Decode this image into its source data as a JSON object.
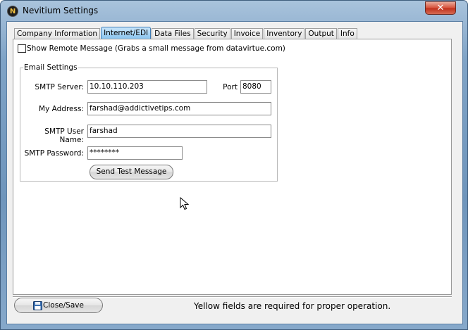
{
  "window": {
    "title": "Nevitium Settings",
    "icon_letter": "N",
    "close_glyph": "✕"
  },
  "tabs": [
    {
      "label": "Company Information",
      "active": false
    },
    {
      "label": "Internet/EDI",
      "active": true
    },
    {
      "label": "Data Files",
      "active": false
    },
    {
      "label": "Security",
      "active": false
    },
    {
      "label": "Invoice",
      "active": false
    },
    {
      "label": "Inventory",
      "active": false
    },
    {
      "label": "Output",
      "active": false
    },
    {
      "label": "Info",
      "active": false
    }
  ],
  "remote_message": {
    "label": "Show Remote Message (Grabs a small message from datavirtue.com)",
    "checked": false
  },
  "email_settings": {
    "legend": "Email Settings",
    "smtp_server_label": "SMTP Server:",
    "smtp_server_value": "10.10.110.203",
    "port_label": "Port",
    "port_value": "8080",
    "address_label": "My Address:",
    "address_value": "farshad@addictivetips.com",
    "user_label": "SMTP User Name:",
    "user_value": "farshad",
    "password_label": "SMTP Password:",
    "password_value": "********",
    "test_button_label": "Send Test Message"
  },
  "footer": {
    "close_label": "Close/Save",
    "close_icon": "floppy-disk-icon",
    "status_text": "Yellow fields are required for proper operation."
  },
  "colors": {
    "active_tab": "#87c2ee",
    "title_bar": "#7fa3c6",
    "close_button": "#c0311c"
  }
}
